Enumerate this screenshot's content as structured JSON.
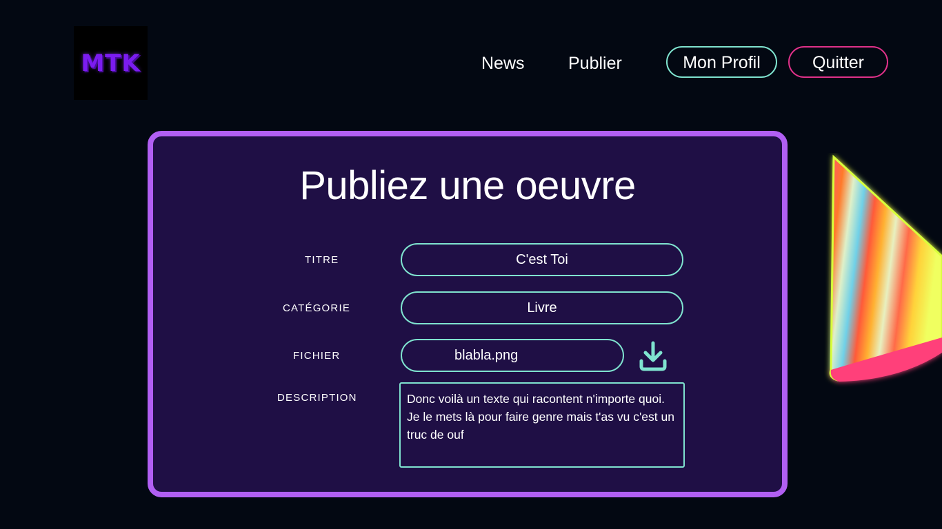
{
  "header": {
    "logo_text": "MTK",
    "nav": {
      "news": "News",
      "publier": "Publier",
      "profil": "Mon Profil",
      "quitter": "Quitter"
    }
  },
  "form": {
    "title": "Publiez une oeuvre",
    "fields": {
      "titre": {
        "label": "TITRE",
        "value": "C'est Toi"
      },
      "categorie": {
        "label": "CATÉGORIE",
        "value": "Livre"
      },
      "fichier": {
        "label": "FICHIER",
        "value": "blabla.png"
      },
      "description": {
        "label": "DESCRIPTION",
        "value": "Donc voilà un texte qui racontent n'importe quoi. Je le mets là pour faire genre mais t'as vu c'est un truc de ouf"
      }
    }
  },
  "icons": {
    "download": "download-icon",
    "decoration": "party-hat"
  },
  "colors": {
    "background": "#030812",
    "card_bg": "#1f0f45",
    "card_border": "#b15ff3",
    "accent_teal": "#7fe3cf",
    "accent_pink": "#e0318a",
    "logo": "#7b1cf0"
  }
}
